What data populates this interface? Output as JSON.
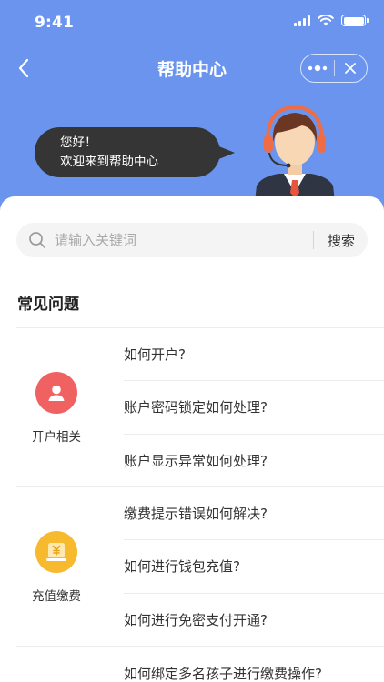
{
  "status_bar": {
    "time": "9:41"
  },
  "nav": {
    "title": "帮助中心"
  },
  "greeting": {
    "line1": "您好！",
    "line2": "欢迎来到帮助中心"
  },
  "search": {
    "placeholder": "请输入关键词",
    "button_label": "搜索"
  },
  "faq": {
    "title": "常见问题",
    "groups": [
      {
        "label": "开户相关",
        "icon": "user-icon",
        "color": "#f06262",
        "questions": [
          "如何开户?",
          "账户密码锁定如何处理?",
          "账户显示异常如何处理?"
        ]
      },
      {
        "label": "充值缴费",
        "icon": "yuan-card-icon",
        "color": "#f7b92e",
        "questions": [
          "缴费提示错误如何解决?",
          "如何进行钱包充值?",
          "如何进行免密支付开通?"
        ]
      },
      {
        "label": "",
        "icon": "",
        "color": "",
        "questions": [
          "如何绑定多名孩子进行缴费操作?"
        ]
      }
    ]
  },
  "colors": {
    "header": "#6a94ee",
    "bubble": "#353535"
  }
}
